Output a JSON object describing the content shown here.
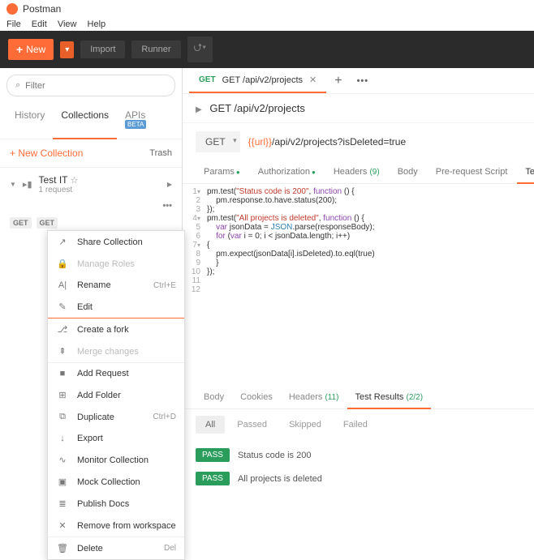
{
  "app": {
    "title": "Postman"
  },
  "menu": [
    "File",
    "Edit",
    "View",
    "Help"
  ],
  "toolbar": {
    "new": "New",
    "import": "Import",
    "runner": "Runner"
  },
  "sidebar": {
    "filter_placeholder": "Filter",
    "tabs": {
      "history": "History",
      "collections": "Collections",
      "apis": "APIs",
      "apis_badge": "BETA"
    },
    "new_collection": "+ New Collection",
    "trash": "Trash",
    "collection": {
      "name": "Test IT",
      "sub": "1 request"
    },
    "reqs": [
      "GET",
      "GET"
    ]
  },
  "context_menu": [
    {
      "icon": "↗",
      "label": "Share Collection",
      "disabled": false
    },
    {
      "icon": "🔒",
      "label": "Manage Roles",
      "disabled": true
    },
    {
      "icon": "A|",
      "label": "Rename",
      "key": "Ctrl+E",
      "disabled": false
    },
    {
      "icon": "✎",
      "label": "Edit",
      "disabled": false,
      "sep_after": "orange"
    },
    {
      "icon": "⎇",
      "label": "Create a fork",
      "disabled": false
    },
    {
      "icon": "⇞",
      "label": "Merge changes",
      "disabled": true,
      "sep_after": "gray"
    },
    {
      "icon": "■",
      "label": "Add Request",
      "disabled": false
    },
    {
      "icon": "⊞",
      "label": "Add Folder",
      "disabled": false
    },
    {
      "icon": "⧉",
      "label": "Duplicate",
      "key": "Ctrl+D",
      "disabled": false
    },
    {
      "icon": "↓",
      "label": "Export",
      "disabled": false
    },
    {
      "icon": "∿",
      "label": "Monitor Collection",
      "disabled": false
    },
    {
      "icon": "▣",
      "label": "Mock Collection",
      "disabled": false
    },
    {
      "icon": "≣",
      "label": "Publish Docs",
      "disabled": false
    },
    {
      "icon": "✕",
      "label": "Remove from workspace",
      "disabled": false,
      "sep_after": "gray"
    },
    {
      "icon": "🗑",
      "label": "Delete",
      "key": "Del",
      "disabled": false
    }
  ],
  "tab": {
    "method": "GET",
    "title": "GET /api/v2/projects"
  },
  "breadcrumb": "GET /api/v2/projects",
  "request": {
    "method": "GET",
    "url_var": "{{url}}",
    "url_rest": "/api/v2/projects?isDeleted=true"
  },
  "req_tabs": {
    "params": "Params",
    "auth": "Authorization",
    "headers": "Headers",
    "headers_count": "(9)",
    "body": "Body",
    "prerequest": "Pre-request Script",
    "tests": "Tests"
  },
  "code": [
    "pm.test(\"Status code is 200\", function () {",
    "    pm.response.to.have.status(200);",
    "});",
    "pm.test(\"All projects is deleted\", function () {",
    "    var jsonData = JSON.parse(responseBody);",
    "    for (var i = 0; i < jsonData.length; i++)",
    "{",
    "    pm.expect(jsonData[i].isDeleted).to.eql(true)",
    "    }",
    "});",
    "",
    ""
  ],
  "resp_tabs": {
    "body": "Body",
    "cookies": "Cookies",
    "headers": "Headers",
    "headers_count": "(11)",
    "results": "Test Results",
    "results_count": "(2/2)"
  },
  "filters": {
    "all": "All",
    "passed": "Passed",
    "skipped": "Skipped",
    "failed": "Failed"
  },
  "results": [
    {
      "badge": "PASS",
      "text": "Status code is 200"
    },
    {
      "badge": "PASS",
      "text": "All projects is deleted"
    }
  ]
}
